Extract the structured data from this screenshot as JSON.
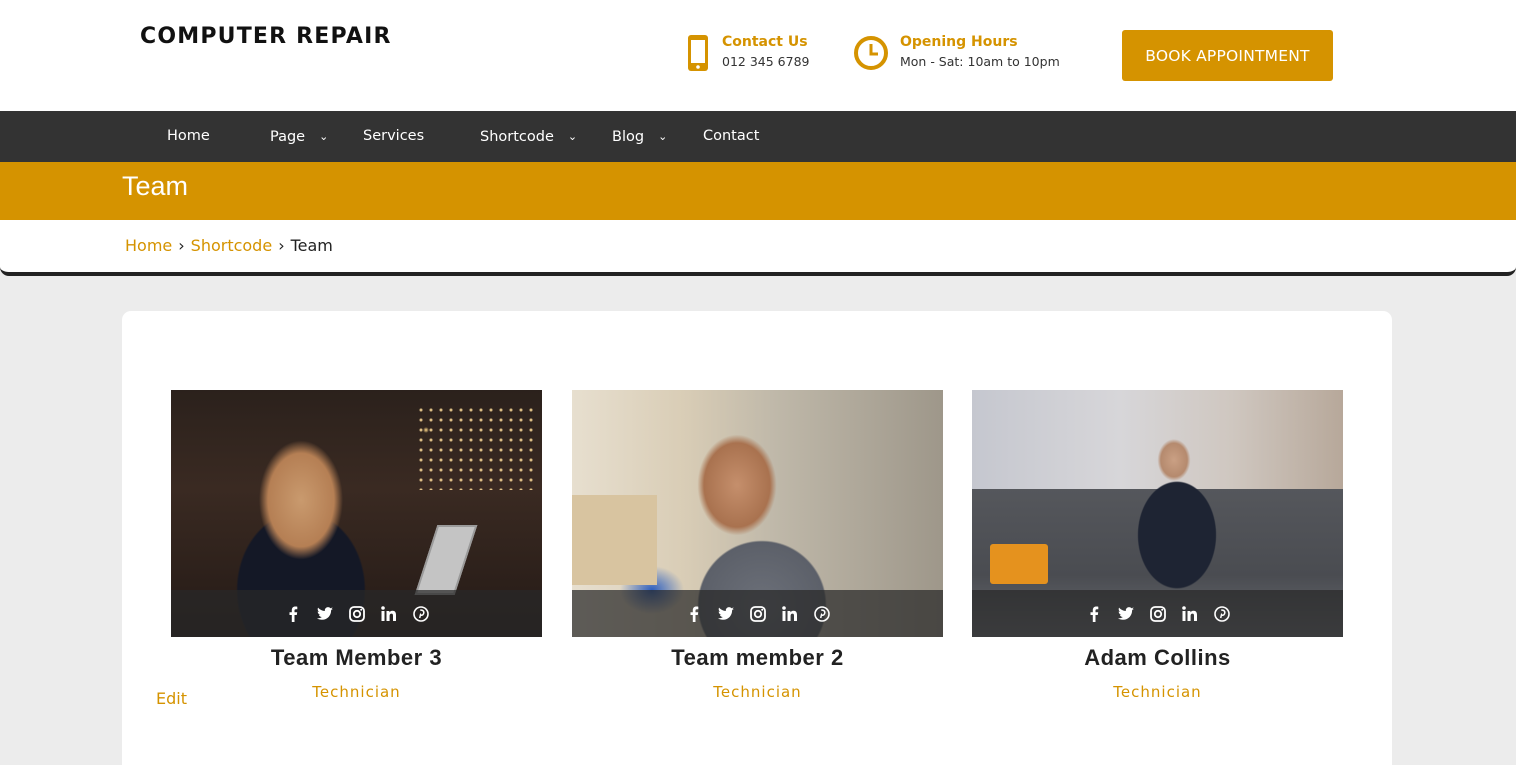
{
  "header": {
    "logo": "COMPUTER REPAIR",
    "contact": {
      "title": "Contact Us",
      "value": "012 345 6789",
      "icon": "phone-icon"
    },
    "hours": {
      "title": "Opening Hours",
      "value": "Mon - Sat: 10am to 10pm",
      "icon": "clock-icon"
    },
    "book_button": "BOOK APPOINTMENT"
  },
  "nav": {
    "items": [
      {
        "label": "Home",
        "has_dropdown": false
      },
      {
        "label": "Page",
        "has_dropdown": true
      },
      {
        "label": "Services",
        "has_dropdown": false
      },
      {
        "label": "Shortcode",
        "has_dropdown": true
      },
      {
        "label": "Blog",
        "has_dropdown": true
      },
      {
        "label": "Contact",
        "has_dropdown": false
      }
    ]
  },
  "page_title": "Team",
  "breadcrumb": {
    "home": "Home",
    "parent": "Shortcode",
    "current": "Team",
    "separator": "›"
  },
  "team": [
    {
      "name": "Team Member 3",
      "role": "Technician"
    },
    {
      "name": "Team member 2",
      "role": "Technician"
    },
    {
      "name": "Adam Collins",
      "role": "Technician"
    }
  ],
  "social_icons": [
    "facebook-icon",
    "twitter-icon",
    "instagram-icon",
    "linkedin-icon",
    "pinterest-icon"
  ],
  "edit_link": "Edit",
  "colors": {
    "accent": "#d59300",
    "nav_bg": "#333333",
    "page_bg": "#ececec"
  }
}
